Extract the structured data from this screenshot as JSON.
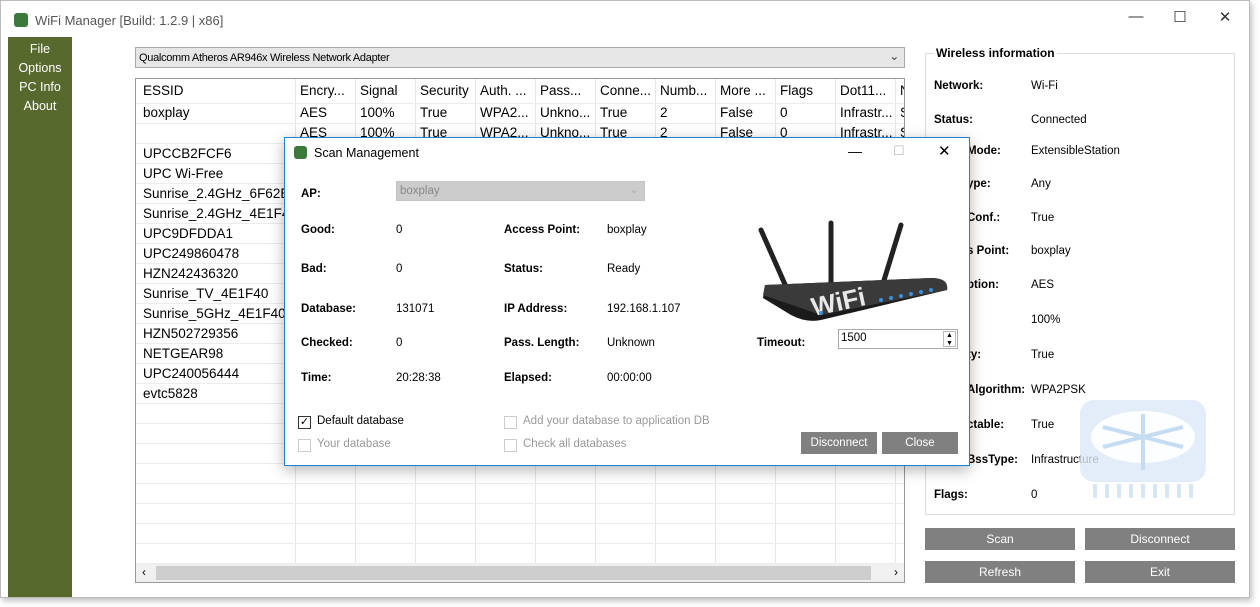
{
  "window": {
    "title": "WiFi Manager [Build: 1.2.9 | x86]",
    "minimize": "—",
    "maximize": "☐",
    "close": "✕"
  },
  "sidebar": {
    "items": [
      {
        "label": "File"
      },
      {
        "label": "Options"
      },
      {
        "label": "PC Info"
      },
      {
        "label": "About"
      }
    ],
    "color": "#58692d"
  },
  "adapter": {
    "selected": "Qualcomm Atheros AR946x Wireless Network Adapter"
  },
  "table": {
    "columns": [
      "ESSID",
      "Encry...",
      "Signal",
      "Security",
      "Auth. ...",
      "Pass...",
      "Conne...",
      "Numb...",
      "More ...",
      "Flags",
      "Dot11...",
      "N"
    ],
    "rows": [
      [
        "boxplay",
        "AES",
        "100%",
        "True",
        "WPA2...",
        "Unkno...",
        "True",
        "2",
        "False",
        "0",
        "Infrastr...",
        "S"
      ],
      [
        "",
        "AES",
        "100%",
        "True",
        "WPA2...",
        "Unkno...",
        "True",
        "2",
        "False",
        "0",
        "Infrastr...",
        "S"
      ],
      [
        "UPCCB2FCF6"
      ],
      [
        "UPC Wi-Free"
      ],
      [
        "Sunrise_2.4GHz_6F62E6"
      ],
      [
        "Sunrise_2.4GHz_4E1F40"
      ],
      [
        "UPC9DFDDA1"
      ],
      [
        "UPC249860478"
      ],
      [
        "HZN242436320"
      ],
      [
        "Sunrise_TV_4E1F40"
      ],
      [
        "Sunrise_5GHz_4E1F40"
      ],
      [
        "HZN502729356"
      ],
      [
        "NETGEAR98"
      ],
      [
        "UPC240056444"
      ],
      [
        "evtc5828"
      ]
    ]
  },
  "wireless_info": {
    "title": "Wireless information",
    "fields": [
      {
        "label": "Network:",
        "value": "Wi-Fi"
      },
      {
        "label": "Status:",
        "value": "Connected"
      },
      {
        "label": "Mode:",
        "value": "ExtensibleStation"
      },
      {
        "label": "ype:",
        "value": "Any"
      },
      {
        "label": "Conf.:",
        "value": "True"
      },
      {
        "label": "s Point:",
        "value": "boxplay"
      },
      {
        "label": "ption:",
        "value": "AES"
      },
      {
        "label": ":",
        "value": "100%"
      },
      {
        "label": "ty:",
        "value": "True"
      },
      {
        "label": "Algorithm:",
        "value": "WPA2PSK"
      },
      {
        "label": "ctable:",
        "value": "True"
      },
      {
        "label": "BssType:",
        "value": "Infrastructure"
      },
      {
        "label": "Flags:",
        "value": "0"
      }
    ]
  },
  "buttons": {
    "scan": "Scan",
    "disconnect": "Disconnect",
    "refresh": "Refresh",
    "exit": "Exit"
  },
  "dialog": {
    "title": "Scan Management",
    "ap_label": "AP:",
    "ap_value": "boxplay",
    "left": [
      {
        "label": "Good:",
        "value": "0"
      },
      {
        "label": "Bad:",
        "value": "0"
      },
      {
        "label": "Database:",
        "value": "131071"
      },
      {
        "label": "Checked:",
        "value": "0"
      },
      {
        "label": "Time:",
        "value": "20:28:38"
      }
    ],
    "right": [
      {
        "label": "Access Point:",
        "value": "boxplay"
      },
      {
        "label": "Status:",
        "value": "Ready"
      },
      {
        "label": "IP Address:",
        "value": "192.168.1.107"
      },
      {
        "label": "Pass. Length:",
        "value": "Unknown"
      },
      {
        "label": "Elapsed:",
        "value": "00:00:00"
      }
    ],
    "router_text": "WiFi",
    "timeout_label": "Timeout:",
    "timeout_value": "1500",
    "checkboxes": [
      {
        "label": "Default database",
        "checked": true,
        "enabled": true
      },
      {
        "label": "Your database",
        "checked": false,
        "enabled": false
      },
      {
        "label": "Add your database to application DB",
        "checked": false,
        "enabled": false
      },
      {
        "label": "Check all databases",
        "checked": false,
        "enabled": false
      }
    ],
    "disconnect": "Disconnect",
    "close": "Close",
    "accent": "#1883d7"
  }
}
